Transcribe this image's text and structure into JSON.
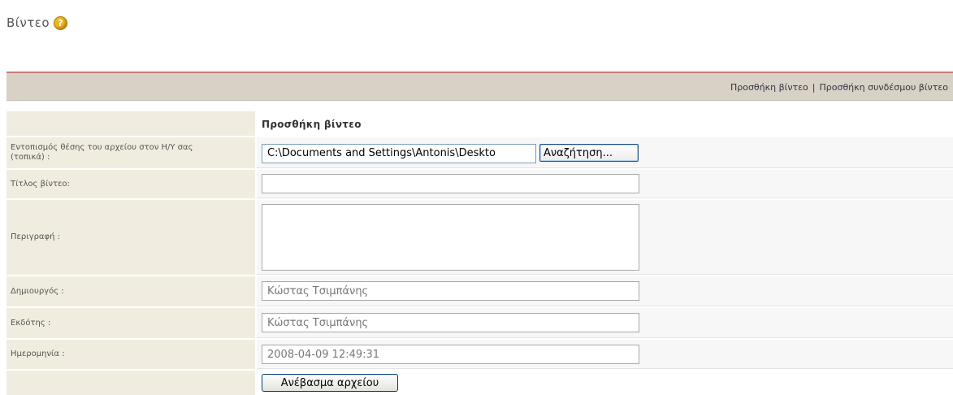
{
  "page": {
    "title": "Βίντεο",
    "help_icon": "?"
  },
  "toolbar": {
    "add_video": "Προσθήκη βίντεο",
    "separator": "|",
    "add_video_link": "Προσθήκη συνδέσμου βίντεο"
  },
  "form": {
    "section_title": "Προσθήκη βίντεο",
    "file_label": "Εντοπισμός θέσης του αρχείου στον Η/Υ σας (τοπικά) :",
    "file_value": "C:\\Documents and Settings\\Antonis\\Deskto",
    "browse_label": "Αναζήτηση...",
    "title_label": "Τίτλος βίντεο:",
    "title_value": "",
    "description_label": "Περιγραφή :",
    "description_value": "",
    "creator_label": "Δημιουργός :",
    "creator_value": "Κώστας Τσιμπάνης",
    "publisher_label": "Εκδότης :",
    "publisher_value": "Κώστας Τσιμπάνης",
    "date_label": "Ημερομηνία :",
    "date_value": "2008-04-09 12:49:31",
    "upload_label": "Ανέβασμα αρχείου"
  }
}
